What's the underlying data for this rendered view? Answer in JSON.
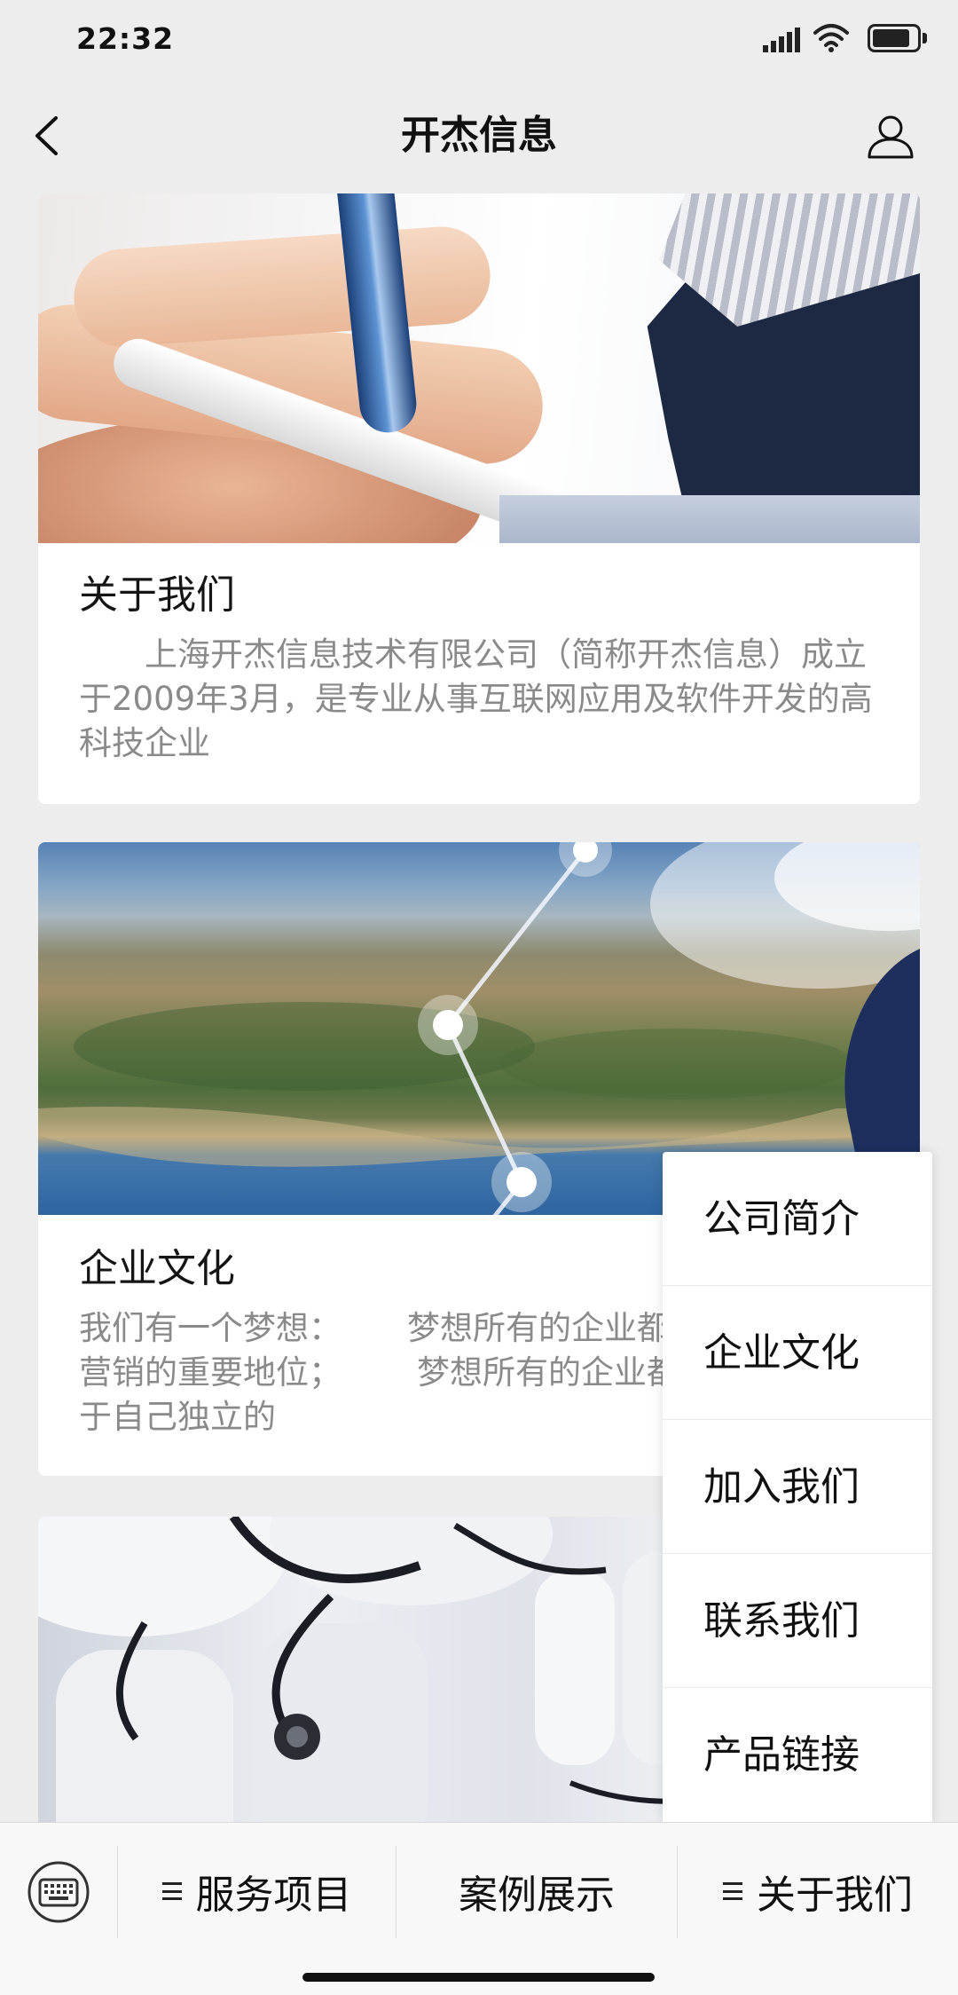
{
  "status_bar": {
    "time": "22:32",
    "battery_level": 0.85,
    "icons": [
      "signal-icon",
      "wifi-icon",
      "battery-icon"
    ]
  },
  "nav": {
    "title": "开杰信息",
    "icons": [
      "back-arrow-icon",
      "user-profile-icon"
    ]
  },
  "cards": [
    {
      "title": "关于我们",
      "description": "上海开杰信息技术有限公司（简称开杰信息）成立于2009年3月，是专业从事互联网应用及软件开发的高科技企业"
    },
    {
      "title": "企业文化",
      "description_lines": [
        {
          "left": "我们有一个梦想：",
          "right": "梦想所有的企业都"
        },
        {
          "left": "营销的重要地位；",
          "right": "梦想所有的企业都"
        },
        {
          "left": "于自己独立的"
        }
      ]
    }
  ],
  "popup_menu": {
    "items": [
      {
        "label": "公司简介"
      },
      {
        "label": "企业文化"
      },
      {
        "label": "加入我们"
      },
      {
        "label": "联系我们"
      },
      {
        "label": "产品链接"
      }
    ]
  },
  "tab_bar": {
    "keyboard_icon": "keyboard-icon",
    "items": [
      {
        "label": "服务项目",
        "icon": "menu-icon"
      },
      {
        "label": "案例展示"
      },
      {
        "label": "关于我们",
        "icon": "menu-icon"
      }
    ]
  }
}
